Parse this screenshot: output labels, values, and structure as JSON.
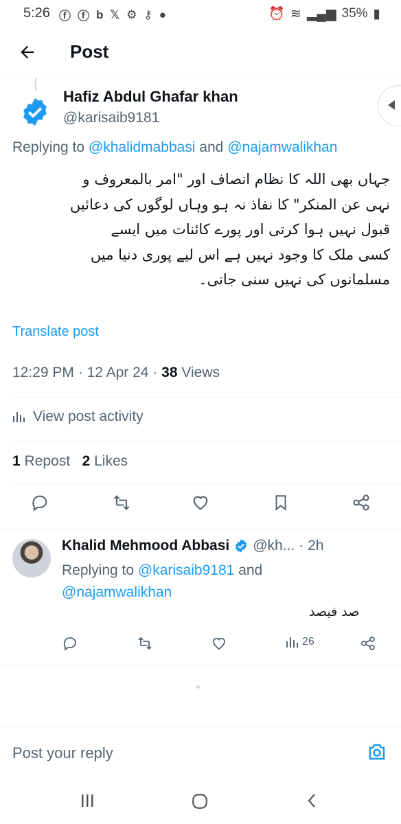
{
  "status_bar": {
    "time": "5:26",
    "left_icons": [
      "facebook-icon",
      "facebook-icon",
      "b-icon",
      "x-icon",
      "settings-icon",
      "key-icon",
      "chat-icon"
    ],
    "battery": "35%"
  },
  "header": {
    "title": "Post"
  },
  "post": {
    "author_name": "Hafiz Abdul Ghafar khan",
    "author_handle": "@karisaib9181",
    "replying_prefix": "Replying to ",
    "replying_user1": "@khalidmabbasi",
    "replying_and": " and ",
    "replying_user2": "@najamwalikhan",
    "body_lines": [
      "جہاں بھی اللہ کا نظام انصاف اور \"امر بالمعروف و",
      "نہی عن المنکر\" کا نفاذ نہ ہو وہاں لوگوں کی دعائیں",
      "قبول نہیں ہوا کرتی اور پورے کائنات میں ایسے",
      "کسی ملک کا وجود نہیں ہے اس لیے پوری دنیا میں",
      "مسلمانوں کی نہیں سنی جاتی۔"
    ],
    "translate": "Translate post",
    "time": "12:29 PM",
    "date": "12 Apr 24",
    "views_count": "38",
    "views_label": "Views",
    "activity": "View post activity",
    "repost_count": "1",
    "repost_label": "Repost",
    "likes_count": "2",
    "likes_label": "Likes"
  },
  "reply": {
    "name": "Khalid Mehmood Abbasi",
    "handle": "@kh...",
    "time": "· 2h",
    "replying_prefix": "Replying to ",
    "replying_user1": "@karisaib9181",
    "replying_and": " and",
    "replying_user2": "@najamwalikhan",
    "text": "صد فیصد",
    "views": "26"
  },
  "composer": {
    "placeholder": "Post your reply"
  },
  "colors": {
    "accent": "#1d9bf0",
    "text": "#0f1419",
    "secondary": "#536471",
    "border": "#eff3f4"
  }
}
